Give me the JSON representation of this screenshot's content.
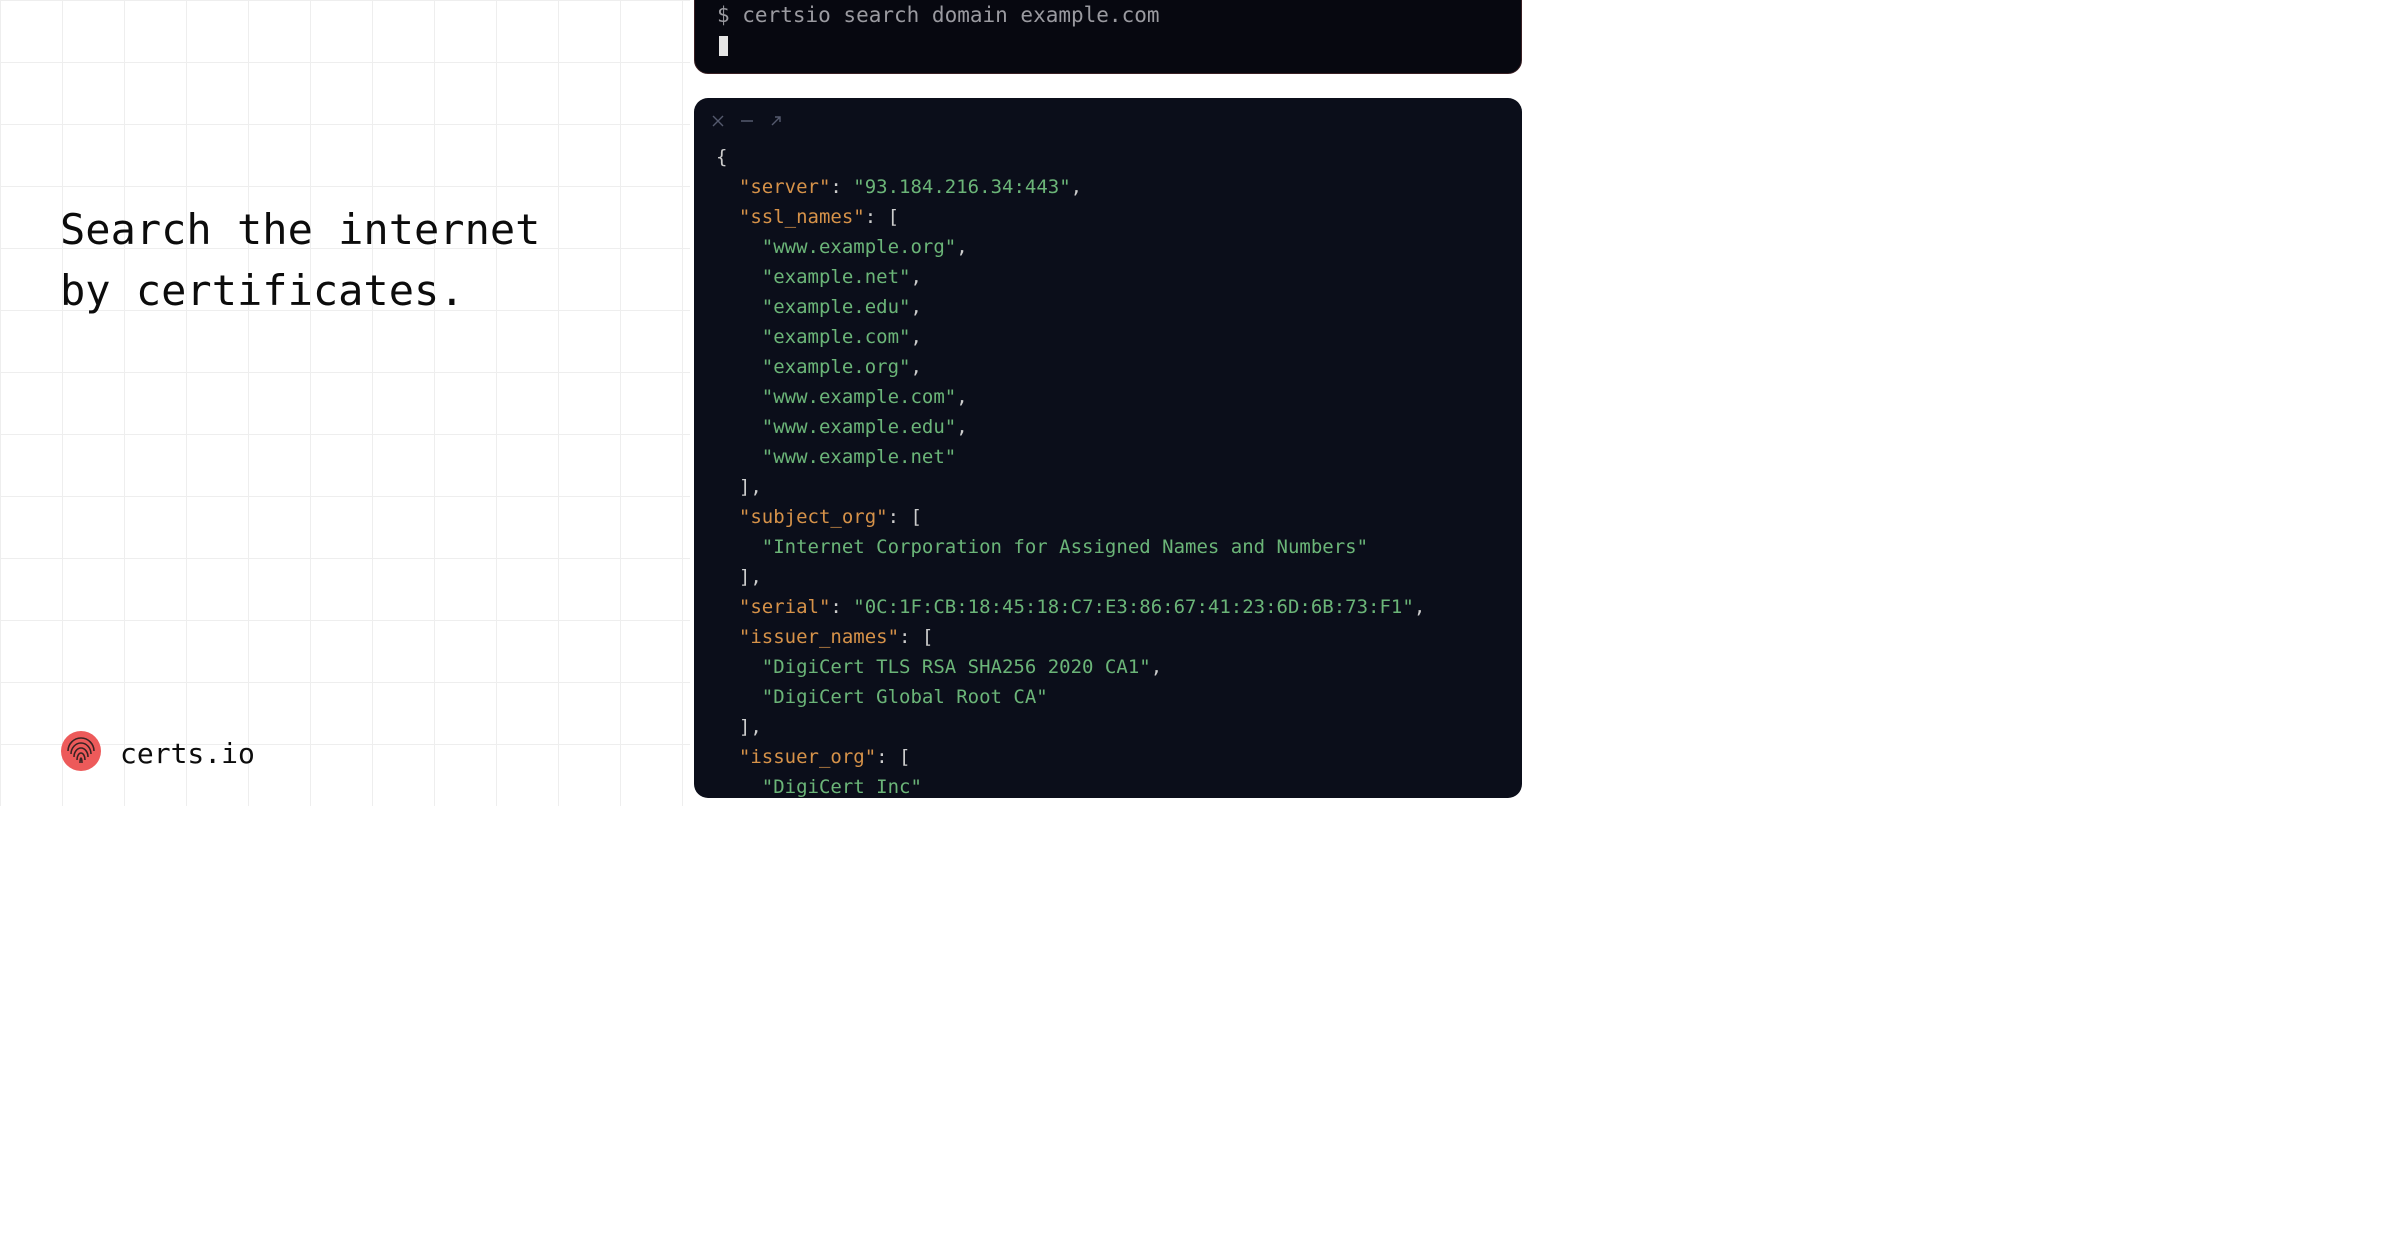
{
  "headline_line1": "Search the internet",
  "headline_line2": "by certificates.",
  "brand_name": "certs.io",
  "brand_accent": "#ed5a5a",
  "terminal": {
    "prompt": "$ certsio search domain example.com"
  },
  "json": {
    "server": "93.184.216.34:443",
    "ssl_names": [
      "www.example.org",
      "example.net",
      "example.edu",
      "example.com",
      "example.org",
      "www.example.com",
      "www.example.edu",
      "www.example.net"
    ],
    "subject_org": [
      "Internet Corporation for Assigned Names and Numbers"
    ],
    "serial": "0C:1F:CB:18:45:18:C7:E3:86:67:41:23:6D:6B:73:F1",
    "issuer_names": [
      "DigiCert TLS RSA SHA256 2020 CA1",
      "DigiCert Global Root CA"
    ],
    "issuer_org": [
      "DigiCert Inc"
    ]
  }
}
